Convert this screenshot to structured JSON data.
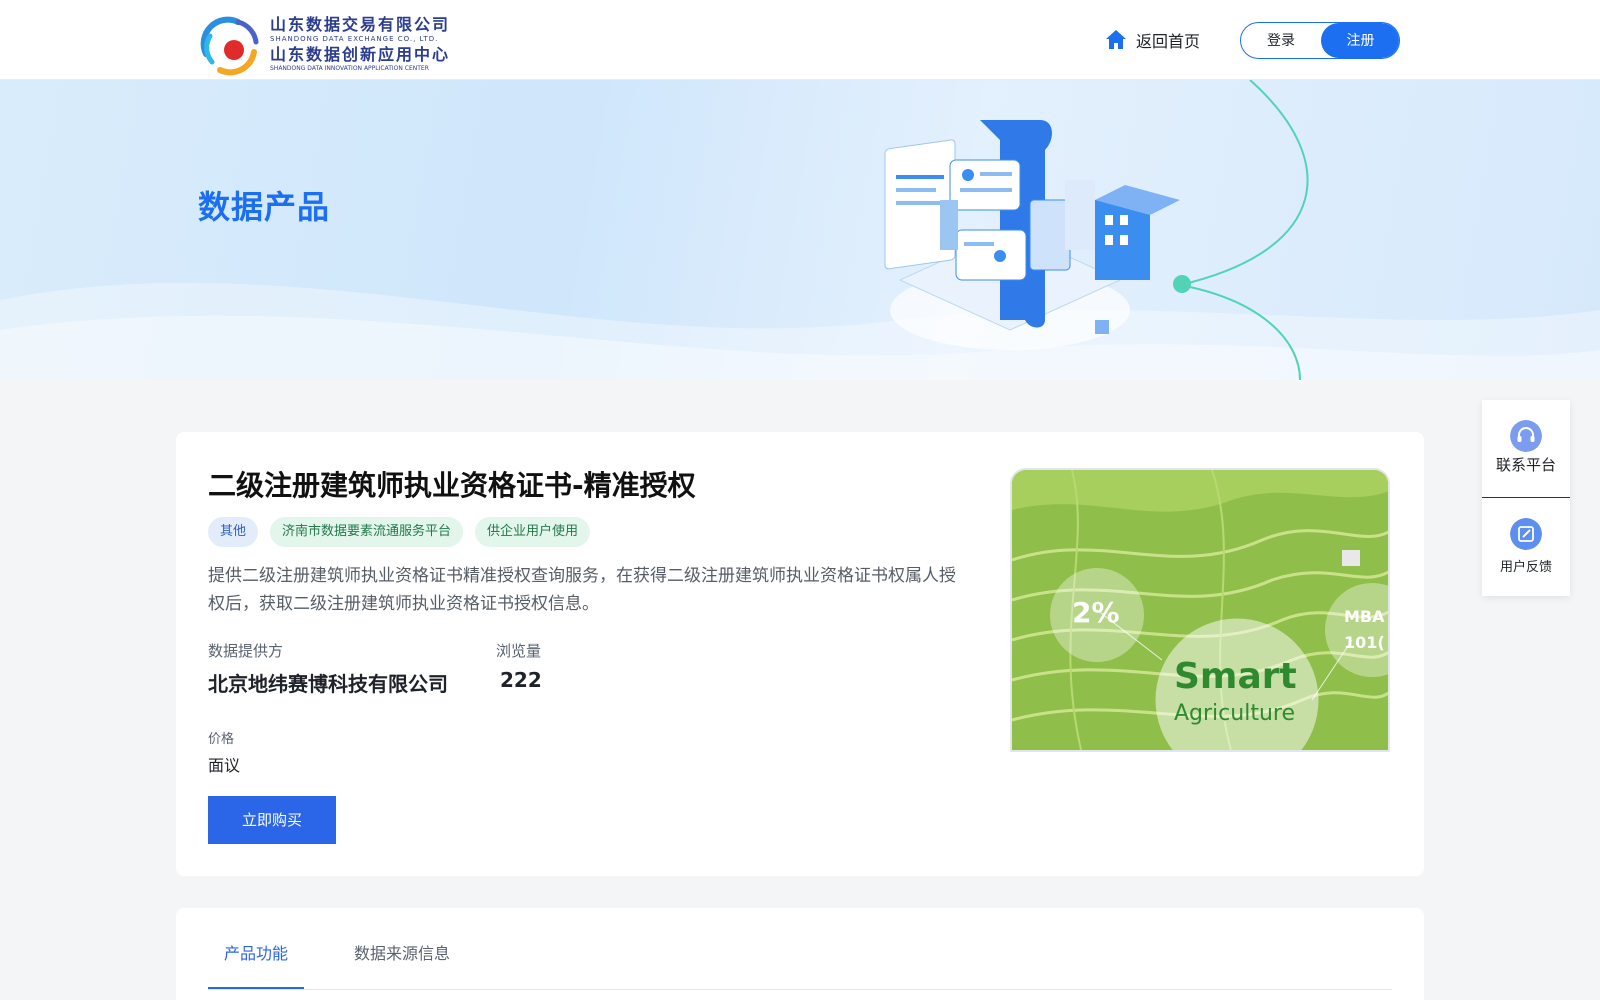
{
  "header": {
    "logo": {
      "line1": "山东数据交易有限公司",
      "line2": "SHANDONG DATA EXCHANGE CO., LTD.",
      "line3": "山东数据创新应用中心",
      "line4": "SHANDONG DATA INNOVATION APPLICATION CENTER"
    },
    "home_label": "返回首页",
    "login_label": "登录",
    "register_label": "注册"
  },
  "banner": {
    "title": "数据产品"
  },
  "product": {
    "title": "二级注册建筑师执业资格证书-精准授权",
    "tags": [
      "其他",
      "济南市数据要素流通服务平台",
      "供企业用户使用"
    ],
    "description": "提供二级注册建筑师执业资格证书精准授权查询服务，在获得二级注册建筑师执业资格证书权属人授权后，获取二级注册建筑师执业资格证书授权信息。",
    "provider_label": "数据提供方",
    "provider_value": "北京地纬赛博科技有限公司",
    "views_label": "浏览量",
    "views_value": "222",
    "price_label": "价格",
    "price_value": "面议",
    "buy_label": "立即购买",
    "image": {
      "badge_percent": "2%",
      "text_main": "Smart",
      "text_sub": "Agriculture",
      "side_text_1": "MBA",
      "side_text_2": "101("
    }
  },
  "tabs": [
    {
      "label": "产品功能",
      "active": true
    },
    {
      "label": "数据来源信息",
      "active": false
    }
  ],
  "float_menu": {
    "contact_label": "联系平台",
    "feedback_label": "用户反馈"
  },
  "colors": {
    "primary": "#1d6ff2",
    "button": "#2c66e8",
    "tag_blue_bg": "#e3ecfb",
    "tag_green_bg": "#e2f6ec"
  }
}
